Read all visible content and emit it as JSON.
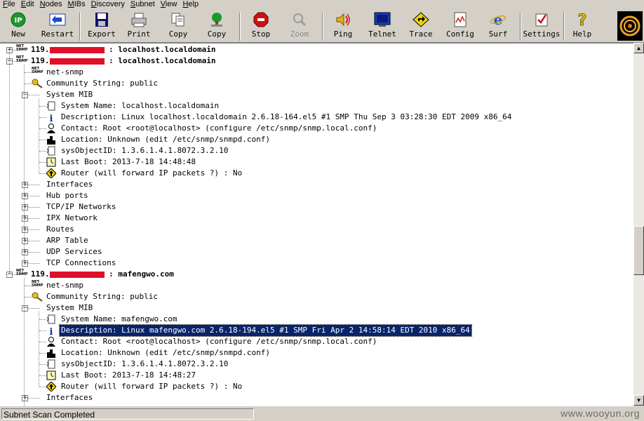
{
  "menu": [
    "File",
    "Edit",
    "Nodes",
    "MIBs",
    "Discovery",
    "Subnet",
    "View",
    "Help"
  ],
  "toolbar": [
    {
      "label": "New",
      "icon": "ip-new-icon",
      "enabled": true
    },
    {
      "label": "Restart",
      "icon": "restart-arrow-icon",
      "enabled": true
    },
    {
      "label": "Export",
      "icon": "floppy-disk-icon",
      "enabled": true
    },
    {
      "label": "Print",
      "icon": "printer-icon",
      "enabled": true
    },
    {
      "label": "Copy",
      "icon": "copy-pages-icon",
      "enabled": true
    },
    {
      "label": "Copy",
      "icon": "copy-tree-icon",
      "enabled": true
    },
    {
      "label": "Stop",
      "icon": "stop-sign-icon",
      "enabled": true
    },
    {
      "label": "Zoom",
      "icon": "zoom-magnifier-icon",
      "enabled": false
    },
    {
      "label": "Ping",
      "icon": "speaker-ping-icon",
      "enabled": true
    },
    {
      "label": "Telnet",
      "icon": "monitor-telnet-icon",
      "enabled": true
    },
    {
      "label": "Trace",
      "icon": "trace-sign-icon",
      "enabled": true
    },
    {
      "label": "Config",
      "icon": "config-document-icon",
      "enabled": true
    },
    {
      "label": "Surf",
      "icon": "ie-browser-icon",
      "enabled": true
    },
    {
      "label": "Settings",
      "icon": "settings-check-icon",
      "enabled": true
    },
    {
      "label": "Help",
      "icon": "help-question-icon",
      "enabled": true
    }
  ],
  "tree": [
    {
      "level": 0,
      "pm": "+",
      "icon": "net-snmp-icon",
      "text": "119.",
      "suffix": ": localhost.localdomain",
      "bold": true,
      "redacted": true
    },
    {
      "level": 0,
      "pm": "-",
      "icon": "net-snmp-icon",
      "text": "119.",
      "suffix": ": localhost.localdomain",
      "bold": true,
      "redacted": true
    },
    {
      "level": 1,
      "pm": "",
      "icon": "net-snmp-icon",
      "text": "net-snmp"
    },
    {
      "level": 1,
      "pm": "",
      "icon": "key-icon",
      "text": "Community String: public"
    },
    {
      "level": 1,
      "pm": "-",
      "icon": "",
      "text": "System MIB"
    },
    {
      "level": 2,
      "pm": "",
      "icon": "mib-doc-icon",
      "text": "System Name: localhost.localdomain"
    },
    {
      "level": 2,
      "pm": "",
      "icon": "info-icon",
      "text": "Description: Linux localhost.localdomain 2.6.18-164.el5 #1 SMP Thu Sep 3 03:28:30 EDT 2009 x86_64"
    },
    {
      "level": 2,
      "pm": "",
      "icon": "person-contact-icon",
      "text": "Contact: Root <root@localhost> (configure /etc/snmp/snmp.local.conf)"
    },
    {
      "level": 2,
      "pm": "",
      "icon": "building-location-icon",
      "text": "Location: Unknown (edit /etc/snmp/snmpd.conf)"
    },
    {
      "level": 2,
      "pm": "",
      "icon": "mib-doc-icon",
      "text": "sysObjectID: 1.3.6.1.4.1.8072.3.2.10"
    },
    {
      "level": 2,
      "pm": "",
      "icon": "clock-boot-icon",
      "text": "Last Boot: 2013-7-18 14:48:48"
    },
    {
      "level": 2,
      "pm": "",
      "icon": "router-sign-icon",
      "text": "Router (will forward IP packets ?) : No"
    },
    {
      "level": 1,
      "pm": "+",
      "icon": "",
      "text": "Interfaces"
    },
    {
      "level": 1,
      "pm": "+",
      "icon": "",
      "text": "Hub ports"
    },
    {
      "level": 1,
      "pm": "+",
      "icon": "",
      "text": "TCP/IP Networks"
    },
    {
      "level": 1,
      "pm": "+",
      "icon": "",
      "text": "IPX Network"
    },
    {
      "level": 1,
      "pm": "+",
      "icon": "",
      "text": "Routes"
    },
    {
      "level": 1,
      "pm": "+",
      "icon": "",
      "text": "ARP Table"
    },
    {
      "level": 1,
      "pm": "+",
      "icon": "",
      "text": "UDP Services"
    },
    {
      "level": 1,
      "pm": "+",
      "icon": "",
      "text": "TCP Connections"
    },
    {
      "level": 0,
      "pm": "-",
      "icon": "net-snmp-icon",
      "text": "119.",
      "suffix": ": mafengwo.com",
      "bold": true,
      "redacted": true
    },
    {
      "level": 1,
      "pm": "",
      "icon": "net-snmp-icon",
      "text": "net-snmp"
    },
    {
      "level": 1,
      "pm": "",
      "icon": "key-icon",
      "text": "Community String: public"
    },
    {
      "level": 1,
      "pm": "-",
      "icon": "",
      "text": "System MIB"
    },
    {
      "level": 2,
      "pm": "",
      "icon": "mib-doc-icon",
      "text": "System Name: mafengwo.com"
    },
    {
      "level": 2,
      "pm": "",
      "icon": "info-icon",
      "text": "Description: Linux mafengwo.com 2.6.18-194.el5 #1 SMP Fri Apr 2 14:58:14 EDT 2010 x86_64",
      "selected": true
    },
    {
      "level": 2,
      "pm": "",
      "icon": "person-contact-icon",
      "text": "Contact: Root <root@localhost> (configure /etc/snmp/snmp.local.conf)"
    },
    {
      "level": 2,
      "pm": "",
      "icon": "building-location-icon",
      "text": "Location: Unknown (edit /etc/snmp/snmpd.conf)"
    },
    {
      "level": 2,
      "pm": "",
      "icon": "mib-doc-icon",
      "text": "sysObjectID: 1.3.6.1.4.1.8072.3.2.10"
    },
    {
      "level": 2,
      "pm": "",
      "icon": "clock-boot-icon",
      "text": "Last Boot: 2013-7-18 14:48:27"
    },
    {
      "level": 2,
      "pm": "",
      "icon": "router-sign-icon",
      "text": "Router (will forward IP packets ?) : No"
    },
    {
      "level": 1,
      "pm": "+",
      "icon": "",
      "text": "Interfaces"
    }
  ],
  "status": {
    "text": "Subnet Scan Completed",
    "watermark": "www.wooyun.org"
  },
  "colors": {
    "selection": "#0a246a",
    "redaction": "#e0102a",
    "face": "#d4d0c8"
  }
}
